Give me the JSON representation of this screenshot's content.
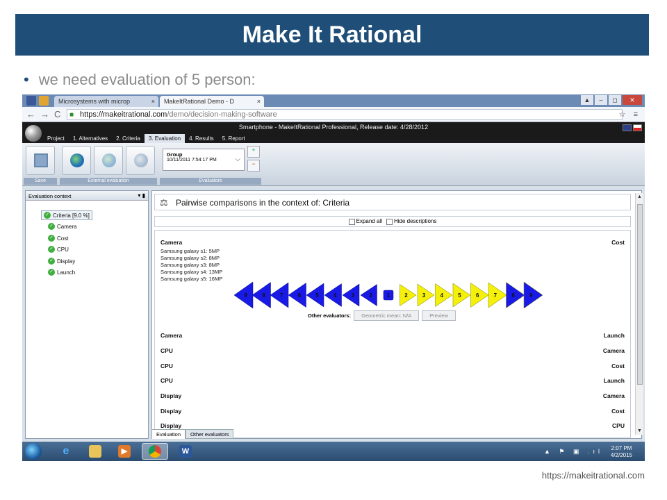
{
  "slide": {
    "title": "Make It Rational",
    "bullet": "we need evaluation of 5 person:",
    "footer_url": "https://makeitrational.com"
  },
  "browser": {
    "tabs": [
      {
        "label": "Microsystems with microp",
        "close": "×"
      },
      {
        "label": "MakeItRational Demo - D",
        "close": "×",
        "active": true
      }
    ],
    "url_host": "https://makeitrational.com",
    "url_path": "/demo/decision-making-software",
    "window_buttons": [
      "▲",
      "–",
      "◻",
      "✕"
    ]
  },
  "app": {
    "title": "Smartphone - MakeItRational Professional, Release date: 4/28/2012",
    "menu": [
      "Project",
      "1. Alternatives",
      "2. Criteria",
      "3. Evaluation",
      "4. Results",
      "5. Report"
    ],
    "active_menu": "3. Evaluation",
    "ribbon": {
      "save_label": "Save",
      "external_label": "External evaluation",
      "evaluators_label": "Evaluators",
      "group_title": "Group",
      "group_date": "10/11/2011 7:54:17 PM"
    },
    "left_panel": {
      "header": "Evaluation context",
      "root": "Criteria [9.0 %]",
      "items": [
        "Camera",
        "Cost",
        "CPU",
        "Display",
        "Launch"
      ]
    },
    "right_panel": {
      "title": "Pairwise comparisons in the context of: Criteria",
      "expand_all": "Expand all",
      "hide_descriptions": "Hide descriptions",
      "first_pair": {
        "left": "Camera",
        "right": "Cost"
      },
      "descriptions": [
        "Samsung galaxy s1: 5MP",
        "Samsung galaxy s2: 8MP",
        "Samsung galaxy s3: 8MP",
        "Samsung galaxy s4: 13MP",
        "Samsung galaxy s5: 16MP"
      ],
      "scale_left": [
        "9",
        "8",
        "7",
        "6",
        "5",
        "4",
        "3",
        "2"
      ],
      "scale_center": "1",
      "scale_right": [
        "2",
        "3",
        "4",
        "5",
        "6",
        "7",
        "8",
        "9"
      ],
      "other_evaluators_label": "Other evaluators:",
      "geometric_mean": "Geometric mean: N/A",
      "preview": "Preview",
      "pairs": [
        {
          "left": "Camera",
          "right": "Launch"
        },
        {
          "left": "CPU",
          "right": "Camera"
        },
        {
          "left": "CPU",
          "right": "Cost"
        },
        {
          "left": "CPU",
          "right": "Launch"
        },
        {
          "left": "Display",
          "right": "Camera"
        },
        {
          "left": "Display",
          "right": "Cost"
        },
        {
          "left": "Display",
          "right": "CPU"
        }
      ]
    },
    "bottom_tabs": [
      "Evaluation",
      "Other evaluators"
    ]
  },
  "taskbar": {
    "time": "2:07 PM",
    "date": "4/2/2015",
    "apps": [
      "ie",
      "explorer",
      "media",
      "chrome",
      "word"
    ]
  },
  "colors": {
    "title_bg": "#1f4e79",
    "scale_blue": "#1a1ae6",
    "scale_yellow": "#f5f00a"
  }
}
